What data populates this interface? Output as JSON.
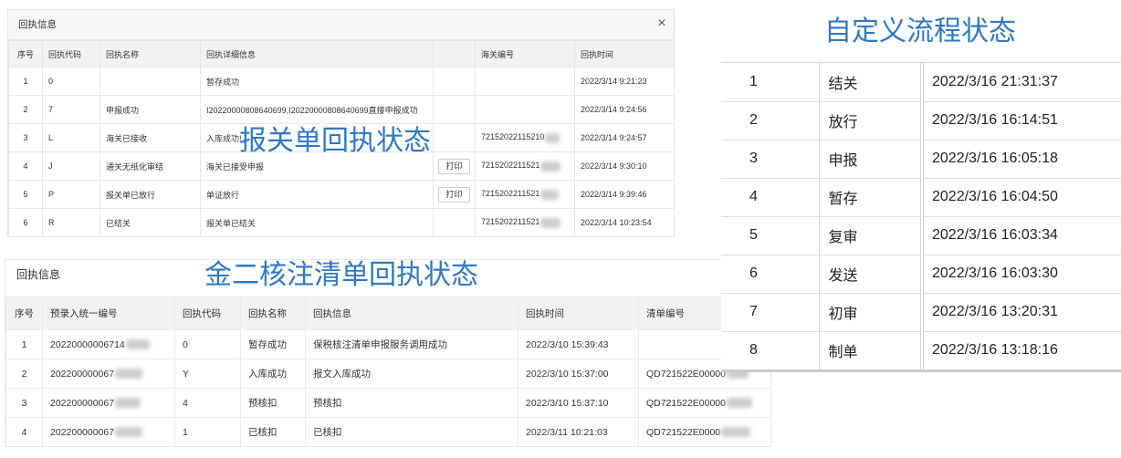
{
  "colors": {
    "accent": "#2f78c4"
  },
  "customs_receipt": {
    "title": "回执信息",
    "close": "×",
    "overlay_title": "报关单回执状态",
    "print_label": "打印",
    "headers": {
      "no": "序号",
      "code": "回执代码",
      "name": "回执名称",
      "detail": "回执详细信息",
      "customs_no": "海关编号",
      "time": "回执时间"
    },
    "rows": [
      {
        "no": "1",
        "code": "0",
        "detail": "暂存成功",
        "time": "2022/3/14 9:21:23"
      },
      {
        "no": "2",
        "code": "7",
        "name": "申报成功",
        "detail": "I20220000808640699,I20220000808640699直接申报成功",
        "time": "2022/3/14 9:24:56"
      },
      {
        "no": "3",
        "code": "L",
        "name": "海关已接收",
        "detail": "入库成功!",
        "customs_no": "72152022115210",
        "time": "2022/3/14 9:24:57"
      },
      {
        "no": "4",
        "code": "J",
        "name": "通关无纸化审结",
        "detail": "海关已接受申报",
        "customs_no": "7215202211521",
        "time": "2022/3/14 9:30:10"
      },
      {
        "no": "5",
        "code": "P",
        "name": "报关单已放行",
        "detail": "单证放行",
        "customs_no": "7215202211521",
        "time": "2022/3/14 9:39:46"
      },
      {
        "no": "6",
        "code": "R",
        "name": "已结关",
        "detail": "报关单已结关",
        "customs_no": "7215202211521",
        "time": "2022/3/14 10:23:54"
      }
    ]
  },
  "inventory_receipt": {
    "title": "回执信息",
    "overlay_title": "金二核注清单回执状态",
    "headers": {
      "no": "序号",
      "pre_entry_no": "预录入统一编号",
      "code": "回执代码",
      "name": "回执名称",
      "info": "回执信息",
      "time": "回执时间",
      "list_no": "清单编号"
    },
    "rows": [
      {
        "no": "1",
        "pre_entry_no": "20220000006714",
        "code": "0",
        "name": "暂存成功",
        "info": "保税核注清单申报服务调用成功",
        "time": "2022/3/10 15:39:43"
      },
      {
        "no": "2",
        "pre_entry_no": "202200000067",
        "code": "Y",
        "name": "入库成功",
        "info": "报文入库成功",
        "time": "2022/3/10 15:37:00",
        "list_no": "QD721522E00000"
      },
      {
        "no": "3",
        "pre_entry_no": "202200000067",
        "code": "4",
        "name": "预核扣",
        "info": "预核扣",
        "time": "2022/3/10 15:37:10",
        "list_no": "QD721522E00000"
      },
      {
        "no": "4",
        "pre_entry_no": "202200000067",
        "code": "1",
        "name": "已核扣",
        "info": "已核扣",
        "time": "2022/3/11 10:21:03",
        "list_no": "QD721522E0000"
      }
    ]
  },
  "custom_flow": {
    "title": "自定义流程状态",
    "rows": [
      {
        "no": "1",
        "status": "结关",
        "time": "2022/3/16 21:31:37"
      },
      {
        "no": "2",
        "status": "放行",
        "time": "2022/3/16 16:14:51"
      },
      {
        "no": "3",
        "status": "申报",
        "time": "2022/3/16 16:05:18"
      },
      {
        "no": "4",
        "status": "暂存",
        "time": "2022/3/16 16:04:50"
      },
      {
        "no": "5",
        "status": "复审",
        "time": "2022/3/16 16:03:34"
      },
      {
        "no": "6",
        "status": "发送",
        "time": "2022/3/16 16:03:30"
      },
      {
        "no": "7",
        "status": "初审",
        "time": "2022/3/16 13:20:31"
      },
      {
        "no": "8",
        "status": "制单",
        "time": "2022/3/16 13:18:16"
      }
    ]
  }
}
